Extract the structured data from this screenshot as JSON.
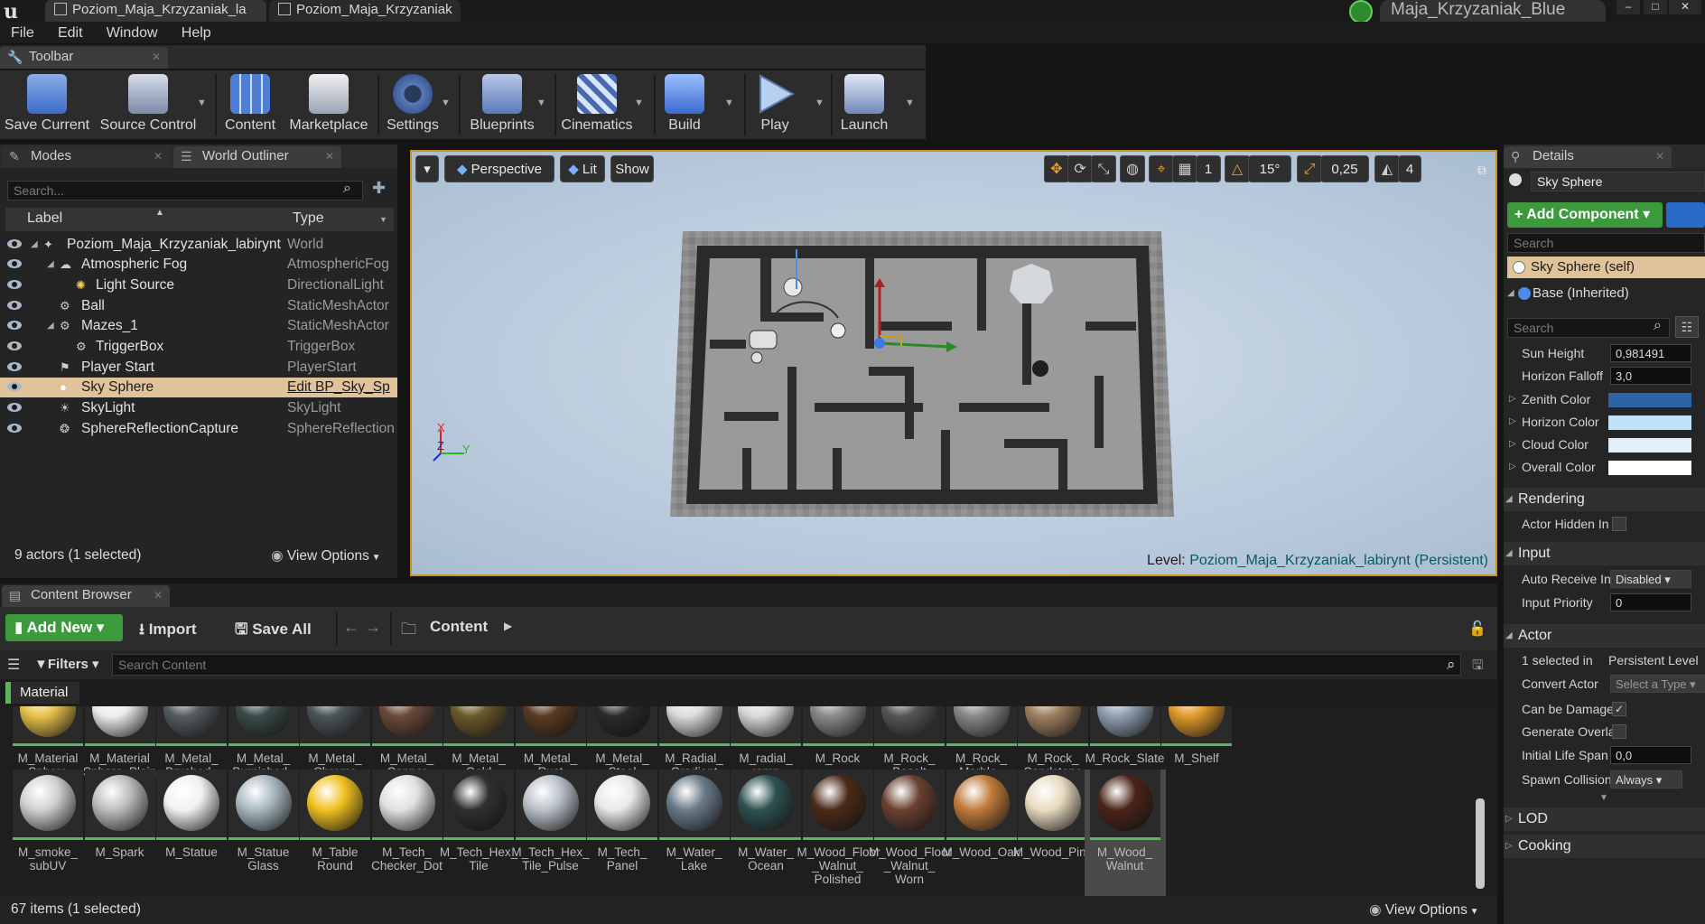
{
  "titlebar": {
    "tab1": "Poziom_Maja_Krzyzaniak_la",
    "tab2": "Poziom_Maja_Krzyzaniak",
    "project": "Maja_Krzyzaniak_Blue"
  },
  "menu": [
    "File",
    "Edit",
    "Window",
    "Help"
  ],
  "toolbar": {
    "tab": "Toolbar",
    "buttons": [
      "Save Current",
      "Source Control",
      "Content",
      "Marketplace",
      "Settings",
      "Blueprints",
      "Cinematics",
      "Build",
      "Play",
      "Launch"
    ]
  },
  "outliner": {
    "tabs": [
      "Modes",
      "World Outliner"
    ],
    "search_placeholder": "Search...",
    "col_label": "Label",
    "col_type": "Type",
    "rows": [
      {
        "label": "Poziom_Maja_Krzyzaniak_labirynt",
        "type": "World"
      },
      {
        "label": "Atmospheric Fog",
        "type": "AtmosphericFog"
      },
      {
        "label": "Light Source",
        "type": "DirectionalLight"
      },
      {
        "label": "Ball",
        "type": "StaticMeshActor"
      },
      {
        "label": "Mazes_1",
        "type": "StaticMeshActor"
      },
      {
        "label": "TriggerBox",
        "type": "TriggerBox"
      },
      {
        "label": "Player Start",
        "type": "PlayerStart"
      },
      {
        "label": "Sky Sphere",
        "type": "Edit BP_Sky_Sp"
      },
      {
        "label": "SkyLight",
        "type": "SkyLight"
      },
      {
        "label": "SphereReflectionCapture",
        "type": "SphereReflection"
      }
    ],
    "status": "9 actors (1 selected)",
    "view_options": "View Options"
  },
  "viewport": {
    "perspective": "Perspective",
    "lit": "Lit",
    "show": "Show",
    "angle": "15°",
    "scale": "0,25",
    "speed": "4",
    "grid": "1",
    "level_prefix": "Level:",
    "level_name": "Poziom_Maja_Krzyzaniak_labirynt (Persistent)",
    "axis_x": "X",
    "axis_y": "Y",
    "axis_z": "Z"
  },
  "details": {
    "tab": "Details",
    "object": "Sky Sphere",
    "add_component": "+ Add Component",
    "search_placeholder": "Search",
    "self_item": "Sky Sphere (self)",
    "base": "Base (Inherited)",
    "search2": "Search",
    "props": [
      {
        "label": "Sun Height",
        "value": "0,981491"
      },
      {
        "label": "Horizon Falloff",
        "value": "3,0"
      }
    ],
    "colors": [
      {
        "label": "Zenith Color",
        "color": "#2b64a5"
      },
      {
        "label": "Horizon Color",
        "color": "#bfe3f5"
      },
      {
        "label": "Cloud Color",
        "color": "#e4eef8"
      },
      {
        "label": "Overall Color",
        "color": "#ffffff"
      }
    ],
    "rendering": "Rendering",
    "actor_hidden": "Actor Hidden In Game",
    "input": "Input",
    "auto_receive": "Auto Receive Input",
    "auto_receive_val": "Disabled",
    "input_priority": "Input Priority",
    "input_priority_val": "0",
    "actor": "Actor",
    "selected_in": "1 selected in",
    "selected_in_val": "Persistent Level",
    "convert_actor": "Convert Actor",
    "convert_actor_val": "Select a Type",
    "can_be_damaged": "Can be Damaged",
    "generate_overlap": "Generate Overlap Events",
    "initial_life": "Initial Life Span",
    "initial_life_val": "0,0",
    "spawn_collision": "Spawn Collision Handling Method",
    "spawn_collision_val": "Always",
    "lod": "LOD",
    "cooking": "Cooking"
  },
  "content_browser": {
    "tab": "Content Browser",
    "add_new": "Add New",
    "import": "Import",
    "save_all": "Save All",
    "path": "Content",
    "filters": "Filters",
    "search_placeholder": "Search Content",
    "filter_chip": "Material",
    "row1": [
      {
        "name": "M_Material Sphere",
        "color": "#e8c24a"
      },
      {
        "name": "M_Material Sphere_Plain",
        "color": "#eeeeee"
      },
      {
        "name": "M_Metal_ Brushed_ Nickel",
        "color": "#555c60"
      },
      {
        "name": "M_Metal_ Burnished_ Steel",
        "color": "#3a4a48"
      },
      {
        "name": "M_Metal_ Chrome",
        "color": "#4c5558"
      },
      {
        "name": "M_Metal_ Copper",
        "color": "#6a4a3a"
      },
      {
        "name": "M_Metal_ Gold",
        "color": "#6a5a2a"
      },
      {
        "name": "M_Metal_ Rust",
        "color": "#5a3a24"
      },
      {
        "name": "M_Metal_ Steel",
        "color": "#2a2a2a"
      },
      {
        "name": "M_Radial_ Gradient",
        "color": "#dddddd"
      },
      {
        "name": "M_radial_ ramp",
        "color": "#d8d8d8"
      },
      {
        "name": "M_Rock",
        "color": "#8a8a8a"
      },
      {
        "name": "M_Rock_ Basalt",
        "color": "#555555"
      },
      {
        "name": "M_Rock_ Marble_ Polished",
        "color": "#888888"
      },
      {
        "name": "M_Rock_ Sandstone",
        "color": "#a08060"
      },
      {
        "name": "M_Rock_Slate",
        "color": "#90a0b0"
      },
      {
        "name": "M_Shelf",
        "color": "#e09a2a"
      }
    ],
    "row2": [
      {
        "name": "M_smoke_ subUV",
        "color": "#d0d0d0"
      },
      {
        "name": "M_Spark",
        "color": "#bdbdbd"
      },
      {
        "name": "M_Statue",
        "color": "#f2f2f2"
      },
      {
        "name": "M_Statue Glass",
        "color": "#a9b9c0"
      },
      {
        "name": "M_Table Round",
        "color": "#f0c020"
      },
      {
        "name": "M_Tech_ Checker_Dot",
        "color": "#e0e0e0"
      },
      {
        "name": "M_Tech_Hex_ Tile",
        "color": "#303030"
      },
      {
        "name": "M_Tech_Hex_ Tile_Pulse",
        "color": "#b8c0c8"
      },
      {
        "name": "M_Tech_ Panel",
        "color": "#e8e8e8"
      },
      {
        "name": "M_Water_ Lake",
        "color": "#6a7a88"
      },
      {
        "name": "M_Water_ Ocean",
        "color": "#2e5050"
      },
      {
        "name": "M_Wood_Floor _Walnut_ Polished",
        "color": "#4a2a18"
      },
      {
        "name": "M_Wood_Floor _Walnut_ Worn",
        "color": "#6a4030"
      },
      {
        "name": "M_Wood_Oak",
        "color": "#c07a3a"
      },
      {
        "name": "M_Wood_Pine",
        "color": "#e8dcc0"
      },
      {
        "name": "M_Wood_ Walnut",
        "color": "#4a2418"
      }
    ],
    "status": "67 items (1 selected)",
    "view_options": "View Options"
  },
  "colors": {
    "selection": "#e0c29b",
    "accent_green": "#3c9a3c",
    "viewport_border": "#c8941f"
  }
}
